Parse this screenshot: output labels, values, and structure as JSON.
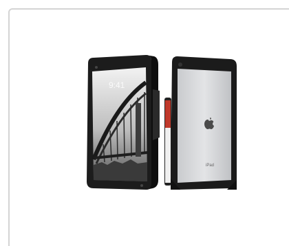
{
  "product": {
    "front_screen_time": "9:41",
    "back_label": "iPad"
  }
}
